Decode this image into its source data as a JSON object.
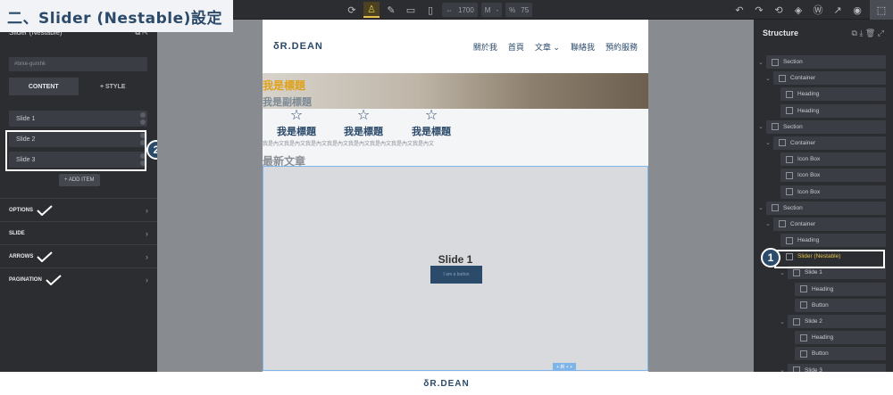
{
  "title_banner": "二、Slider (Nestable)設定",
  "toolbar": {
    "width_value": "1700",
    "field_m": "M",
    "field_dash": "-",
    "percent": "%",
    "zoom_value": "75"
  },
  "left_panel": {
    "heading": "Slider (Nestable)",
    "id_field": "#brxe-gurxhk",
    "tabs": [
      "CONTENT",
      "+ STYLE"
    ],
    "slides": [
      "Slide 1",
      "Slide 2",
      "Slide 3"
    ],
    "add_item": "+ ADD ITEM",
    "sections": [
      "OPTIONS",
      "SLIDE",
      "ARROWS",
      "PAGINATION"
    ]
  },
  "badges": [
    "1",
    "2"
  ],
  "site": {
    "logo": "δR.DEAN",
    "menu": [
      "關於我",
      "首頁",
      "文章",
      "聯絡我",
      "預約服務"
    ],
    "hero_title": "我是標題",
    "hero_subtitle": "我是副標題",
    "icon_boxes": [
      "我是標題",
      "我是標題",
      "我是標題"
    ],
    "description": "我是內文我是內文我是內文我是內文我是內文我是內文我是內文我是內文",
    "latest": "最新文章",
    "slide_heading": "Slide 1",
    "slide_button": "I am a button",
    "slider_tag": "+ 新 + +"
  },
  "structure": {
    "title": "Structure",
    "nodes": [
      {
        "label": "Section",
        "depth": 0,
        "caret": true
      },
      {
        "label": "Container",
        "depth": 1,
        "caret": true
      },
      {
        "label": "Heading",
        "depth": 2,
        "caret": false
      },
      {
        "label": "Heading",
        "depth": 2,
        "caret": false
      },
      {
        "label": "Section",
        "depth": 0,
        "caret": true
      },
      {
        "label": "Container",
        "depth": 1,
        "caret": true
      },
      {
        "label": "Icon Box",
        "depth": 2,
        "caret": false
      },
      {
        "label": "Icon Box",
        "depth": 2,
        "caret": false
      },
      {
        "label": "Icon Box",
        "depth": 2,
        "caret": false
      },
      {
        "label": "Section",
        "depth": 0,
        "caret": true
      },
      {
        "label": "Container",
        "depth": 1,
        "caret": true
      },
      {
        "label": "Heading",
        "depth": 2,
        "caret": false
      },
      {
        "label": "Slider (Nestable)",
        "depth": 2,
        "caret": false,
        "selected": true
      },
      {
        "label": "Slide 1",
        "depth": 3,
        "caret": true
      },
      {
        "label": "Heading",
        "depth": 4,
        "caret": false
      },
      {
        "label": "Button",
        "depth": 4,
        "caret": false
      },
      {
        "label": "Slide 2",
        "depth": 3,
        "caret": true
      },
      {
        "label": "Heading",
        "depth": 4,
        "caret": false
      },
      {
        "label": "Button",
        "depth": 4,
        "caret": false
      },
      {
        "label": "Slide 3",
        "depth": 3,
        "caret": true
      }
    ]
  },
  "footer_logo": "δR.DEAN",
  "colors": {
    "accent": "#e6c04a",
    "brand": "#2c4a6a"
  }
}
